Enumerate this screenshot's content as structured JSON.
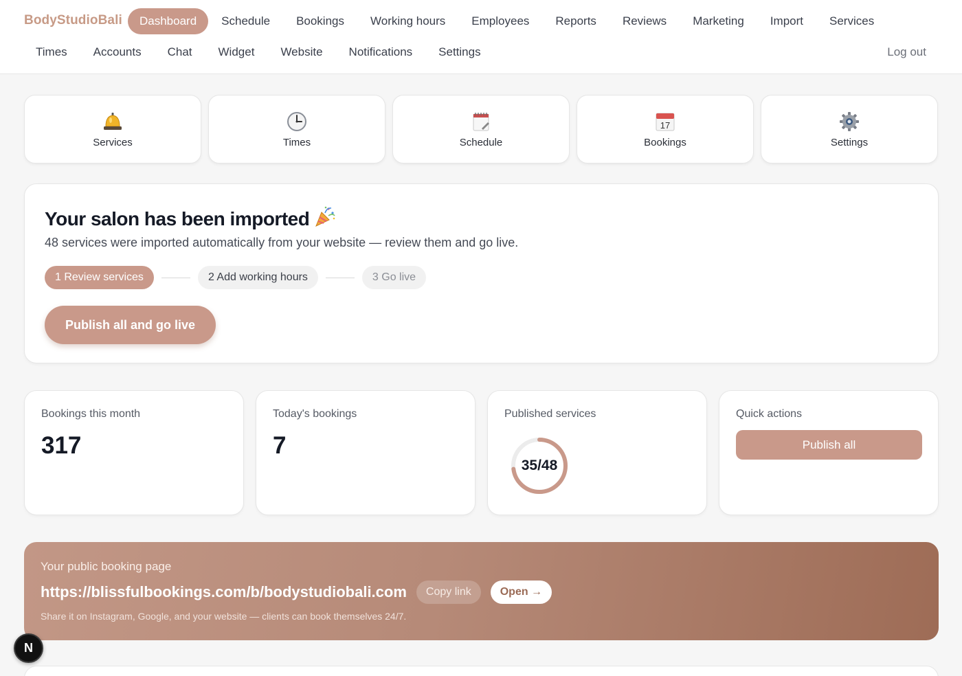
{
  "brand": {
    "name": "BodyStudioBali"
  },
  "nav": {
    "row1": [
      "Dashboard",
      "Schedule",
      "Bookings",
      "Working hours",
      "Employees",
      "Reports",
      "Reviews",
      "Marketing",
      "Import",
      "Services"
    ],
    "row2": [
      "Times",
      "Accounts",
      "Chat",
      "Widget",
      "Website",
      "Notifications",
      "Settings"
    ],
    "active": "Dashboard",
    "logout": "Log out"
  },
  "tiles": [
    {
      "label": "Services",
      "icon": "bell-icon"
    },
    {
      "label": "Times",
      "icon": "clock-icon"
    },
    {
      "label": "Schedule",
      "icon": "notepad-icon"
    },
    {
      "label": "Bookings",
      "icon": "calendar-icon",
      "icon_text": "17"
    },
    {
      "label": "Settings",
      "icon": "gear-icon"
    }
  ],
  "import": {
    "title": "Your salon has been imported",
    "title_icon": "party-popper-icon",
    "subtitle": "48 services were imported automatically from your website — review them and go live.",
    "steps": [
      "1 Review services",
      "2 Add working hours",
      "3 Go live"
    ],
    "cta": "Publish all and go live"
  },
  "stats": {
    "bookings_month": {
      "label": "Bookings this month",
      "value": "317"
    },
    "bookings_today": {
      "label": "Today's bookings",
      "value": "7"
    },
    "published": {
      "label": "Published services",
      "value": "35/48",
      "published": 35,
      "total": 48
    },
    "quick": {
      "label": "Quick actions",
      "button": "Publish all"
    }
  },
  "banner": {
    "label": "Your public booking page",
    "url": "https://blissfulbookings.com/b/bodystudiobali.com",
    "copy": "Copy link",
    "open": "Open →",
    "note": "Share it on Instagram, Google, and your website — clients can book themselves 24/7."
  },
  "badge": {
    "letter": "N"
  },
  "colors": {
    "accent": "#c9998a",
    "brand": "#c79a86"
  }
}
